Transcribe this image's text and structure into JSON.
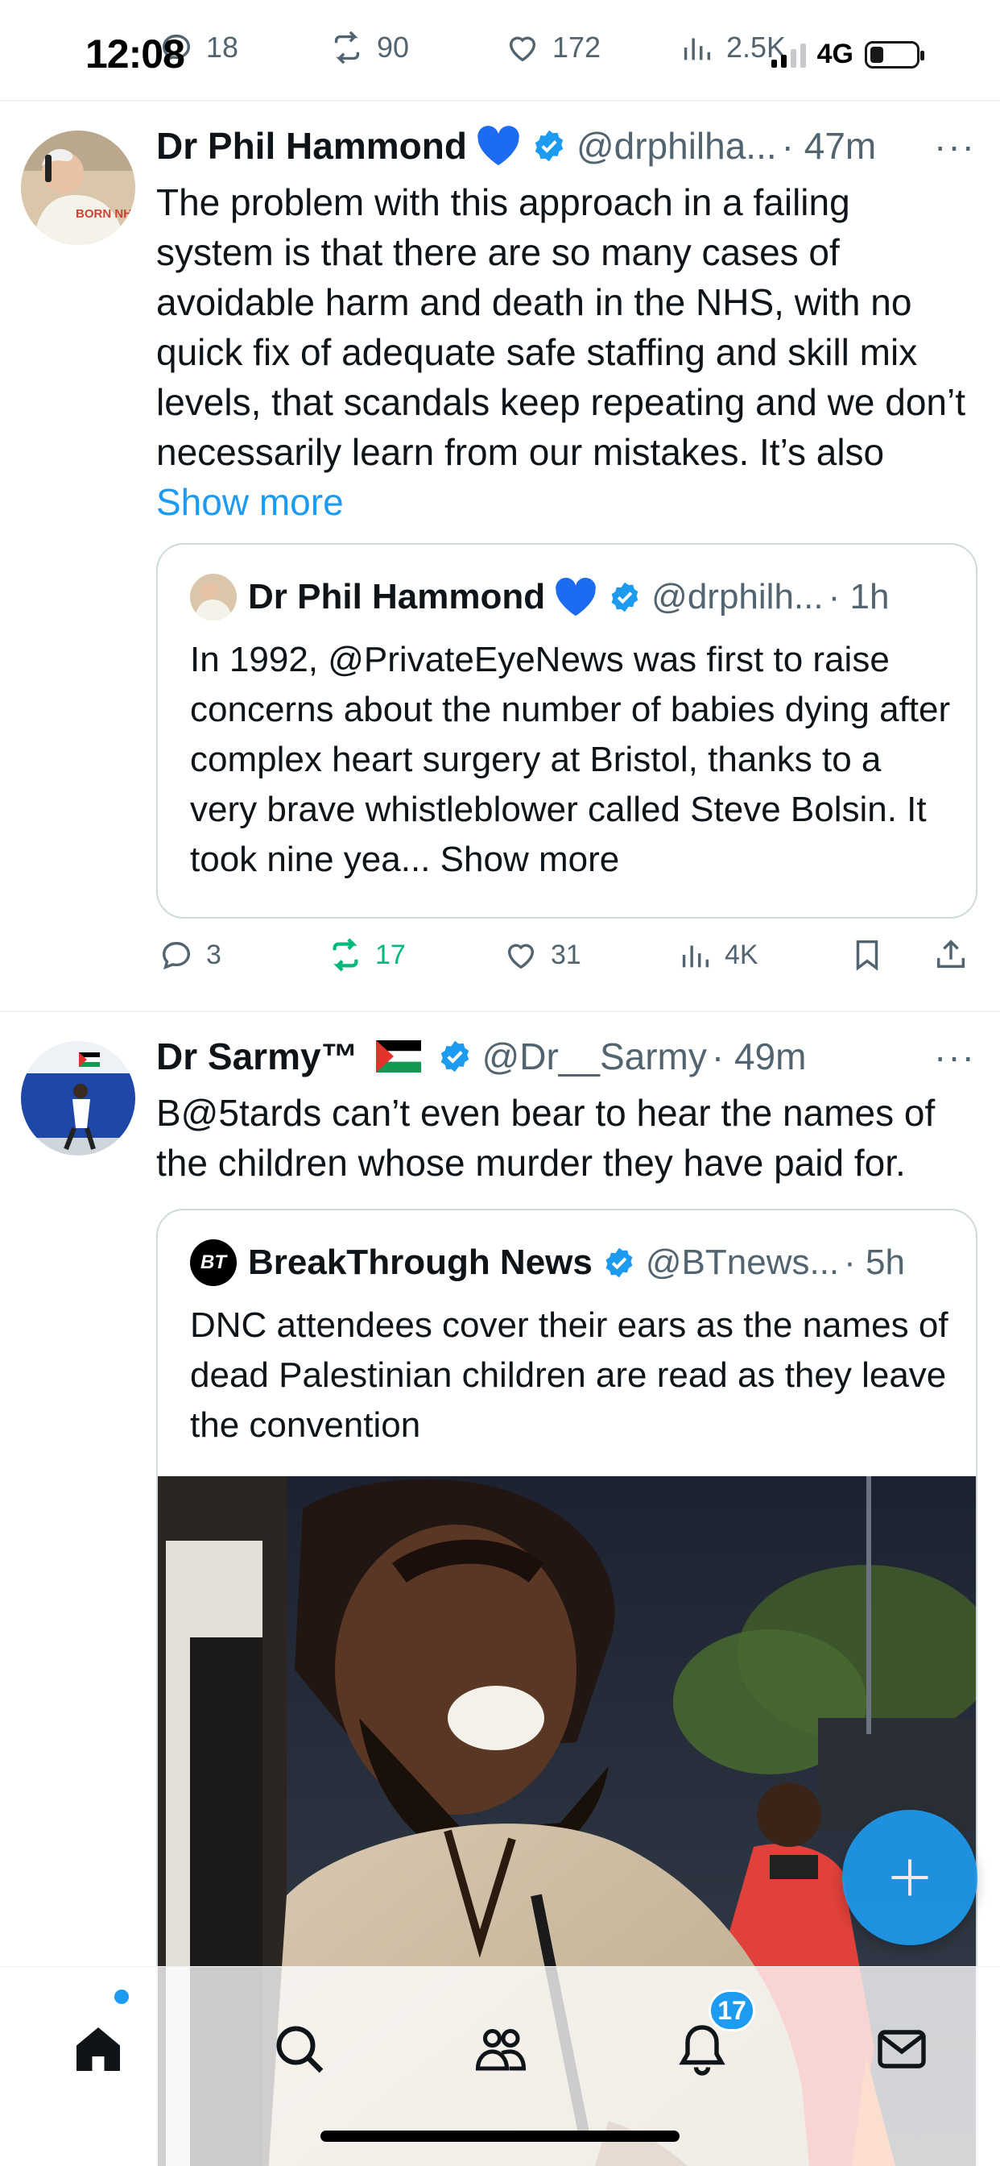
{
  "status_bar": {
    "time": "12:08",
    "network": "4G"
  },
  "prev_tweet_actions": {
    "replies": "18",
    "reposts": "90",
    "likes": "172",
    "views": "2.5K"
  },
  "tweets": [
    {
      "name": "Dr Phil Hammond",
      "name_emoji": "blue-heart",
      "handle": "@drphilha...",
      "time": "· 47m",
      "body": "The problem with this approach in a failing system is that there are so many cases of avoidable harm and death in the NHS, with no quick fix of adequate safe staffing and skill mix levels, that scandals keep repeating and we don’t necessarily learn from our mistakes. It’s also",
      "show_more": "Show more",
      "avatar_text": "BORN NHS",
      "quote": {
        "name": "Dr Phil Hammond",
        "handle": "@drphilh...",
        "time": "· 1h",
        "body": "In 1992, @PrivateEyeNews was first to raise concerns about the number of babies dying after complex heart surgery at Bristol, thanks to a very brave whistleblower called Steve Bolsin. It took nine yea...",
        "show_more": "Show more"
      },
      "actions": {
        "replies": "3",
        "reposts": "17",
        "likes": "31",
        "views": "4K"
      }
    },
    {
      "name": "Dr Sarmy™",
      "name_emoji": "palestine-flag",
      "handle": "@Dr__Sarmy",
      "time": "· 49m",
      "body": "B@5tards can’t even bear to hear the names of the children whose murder they have paid for.",
      "quote": {
        "name": "BreakThrough News",
        "avatar_text": "BT",
        "handle": "@BTnews...",
        "time": "· 5h",
        "body": "DNC attendees cover their ears as the names of dead Palestinian children are read as they leave the convention"
      }
    }
  ],
  "nav": {
    "notifications_badge": "17"
  },
  "colors": {
    "accent": "#1d9bf0",
    "repost_active": "#00ba7c",
    "muted": "#536471"
  }
}
